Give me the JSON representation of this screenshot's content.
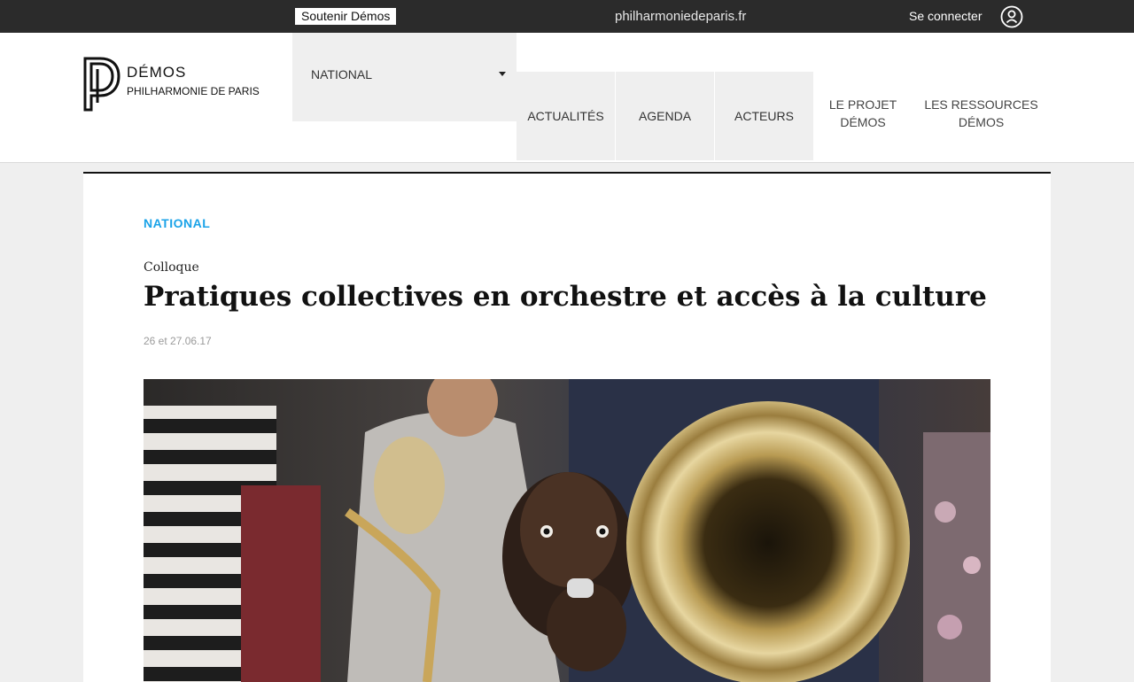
{
  "topbar": {
    "support_label": "Soutenir Démos",
    "site_link": "philharmoniedeparis.fr",
    "login_label": "Se connecter"
  },
  "logo": {
    "title": "DÉMOS",
    "subtitle": "PHILHARMONIE DE PARIS"
  },
  "nav": {
    "region_select": "NATIONAL",
    "tabs": [
      "ACTUALITÉS",
      "AGENDA",
      "ACTEURS"
    ],
    "projet_line1": "LE PROJET",
    "projet_line2": "DÉMOS",
    "ressources_line1": "LES RESSOURCES",
    "ressources_line2": "DÉMOS"
  },
  "article": {
    "tag": "NATIONAL",
    "kicker": "Colloque",
    "title": "Pratiques collectives en orchestre et accès à la culture",
    "date": "26 et 27.06.17"
  },
  "colors": {
    "accent": "#1aa3e8",
    "topbar": "#2b2b2b",
    "background": "#efefef"
  },
  "icons": {
    "user": "user-circle-icon",
    "caret": "caret-down-icon"
  }
}
